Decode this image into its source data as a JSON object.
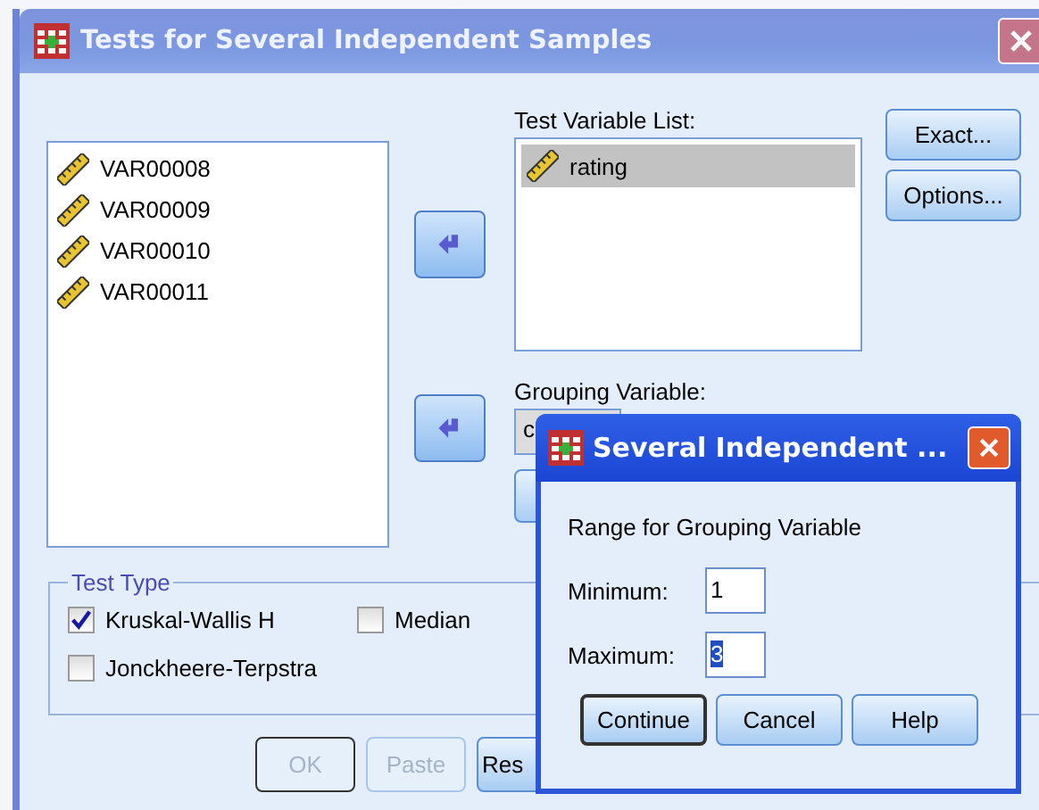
{
  "window": {
    "title": "Tests for Several Independent Samples"
  },
  "source_list": {
    "items": [
      {
        "name": "VAR00008"
      },
      {
        "name": "VAR00009"
      },
      {
        "name": "VAR00010"
      },
      {
        "name": "VAR00011"
      }
    ]
  },
  "test_variable_list": {
    "label": "Test Variable List:",
    "items": [
      {
        "name": "rating",
        "selected": true
      }
    ]
  },
  "side_buttons": [
    "Exact...",
    "Options..."
  ],
  "grouping_variable": {
    "label": "Grouping Variable:",
    "value": "c"
  },
  "test_type": {
    "title": "Test Type",
    "options": [
      {
        "label": "Kruskal-Wallis H",
        "checked": true
      },
      {
        "label": "Median",
        "checked": false
      },
      {
        "label": "Jonckheere-Terpstra",
        "checked": false
      }
    ]
  },
  "buttons": [
    {
      "label": "OK",
      "disabled": true
    },
    {
      "label": "Paste",
      "disabled": true
    },
    {
      "label": "Res",
      "disabled": false
    }
  ],
  "subdialog": {
    "title": "Several Independent ...",
    "heading": "Range for Grouping Variable",
    "fields": [
      {
        "label": "Minimum:",
        "value": "1",
        "selected": false
      },
      {
        "label": "Maximum:",
        "value": "3",
        "selected": true
      }
    ],
    "buttons": [
      {
        "label": "Continue",
        "default": true
      },
      {
        "label": "Cancel",
        "default": false
      },
      {
        "label": "Help",
        "default": false
      }
    ]
  }
}
